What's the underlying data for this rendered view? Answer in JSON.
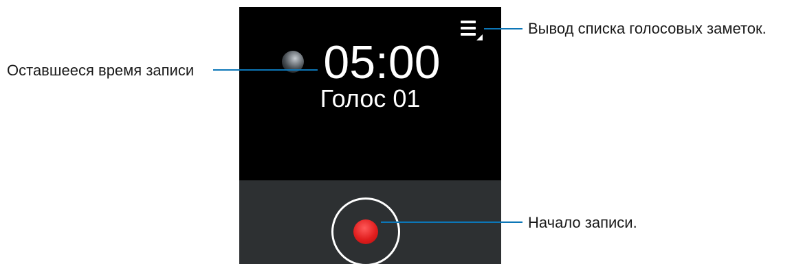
{
  "screen": {
    "timer": "05:00",
    "file_name": "Голос 01",
    "colors": {
      "screen_bg": "#000000",
      "controls_bg": "#2d3032",
      "record_button": "#e11e1e",
      "callout_line": "#0c76b7"
    },
    "icons": {
      "menu": "list-menu-icon",
      "recording_indicator": "recording-status-icon",
      "record": "record-icon"
    }
  },
  "callouts": {
    "remaining_time": "Оставшееся время записи",
    "voice_memo_list": "Вывод списка голосовых заметок.",
    "start_recording": "Начало записи."
  }
}
